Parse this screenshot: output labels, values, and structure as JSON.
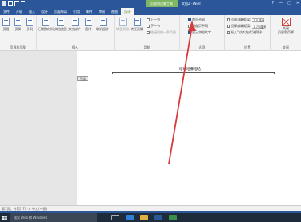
{
  "titlebar": {
    "context_group": "页眉和页脚工具",
    "doc_title": "文档2 - Word",
    "controls": [
      "?",
      "—",
      "□",
      "✕"
    ]
  },
  "tabs": [
    "文件",
    "开始",
    "插入",
    "设计",
    "页面布局",
    "引用",
    "邮件",
    "审阅",
    "视图",
    "设计"
  ],
  "ribbon": {
    "group1": {
      "buttons": [
        "页眉",
        "页脚",
        "页码"
      ],
      "label": "页眉和页脚"
    },
    "group2": {
      "buttons": [
        "日期和时间",
        "文档信息",
        "文档部件",
        "图片",
        "联机图片"
      ],
      "label": "插入"
    },
    "group3": {
      "buttons": [
        "转至页眉",
        "转至页脚"
      ],
      "small": [
        "上一节",
        "下一节",
        "链接到前一条页眉"
      ],
      "label": "导航"
    },
    "group4": {
      "options": [
        "首页不同",
        "奇偶页不同",
        "显示文档文字"
      ],
      "label": "选项"
    },
    "group5": {
      "rows": [
        "页眉顶端距离:",
        "页脚底端距离:",
        "插入\"对齐方式\"选项卡"
      ],
      "values": [
        "1.5 厘米",
        "1.75 厘米"
      ],
      "label": "位置"
    },
    "group6": {
      "button": "关闭\n页眉和页脚",
      "label": "关闭"
    }
  },
  "page": {
    "header_text": "哈哈哈撒哈哈",
    "header_tag": "页眉"
  },
  "statusbar": {
    "text": "第1页，共1页   7个字    中文(中国)"
  },
  "taskbar": {
    "search": "搜索 Web 和 Windows"
  },
  "colors": {
    "accent": "#2b579a",
    "context": "#7fb661",
    "arrow": "#d83a3a"
  }
}
